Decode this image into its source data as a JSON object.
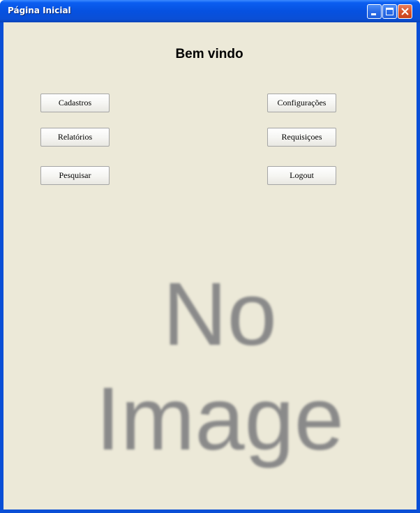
{
  "window": {
    "title": "Página Inicial",
    "controls": [
      "minimize-icon",
      "maximize-icon",
      "close-icon"
    ],
    "accent_color": "#0a4fd6",
    "background_color": "#ece9d8"
  },
  "main": {
    "heading": "Bem vindo",
    "buttons": {
      "cadastros": "Cadastros",
      "configuracoes": "Configurações",
      "relatorios": "Relatórios",
      "requisicoes": "Requisiçoes",
      "pesquisar": "Pesquisar",
      "logout": "Logout"
    },
    "image_placeholder": {
      "line1": "No",
      "line2": "Image"
    }
  }
}
